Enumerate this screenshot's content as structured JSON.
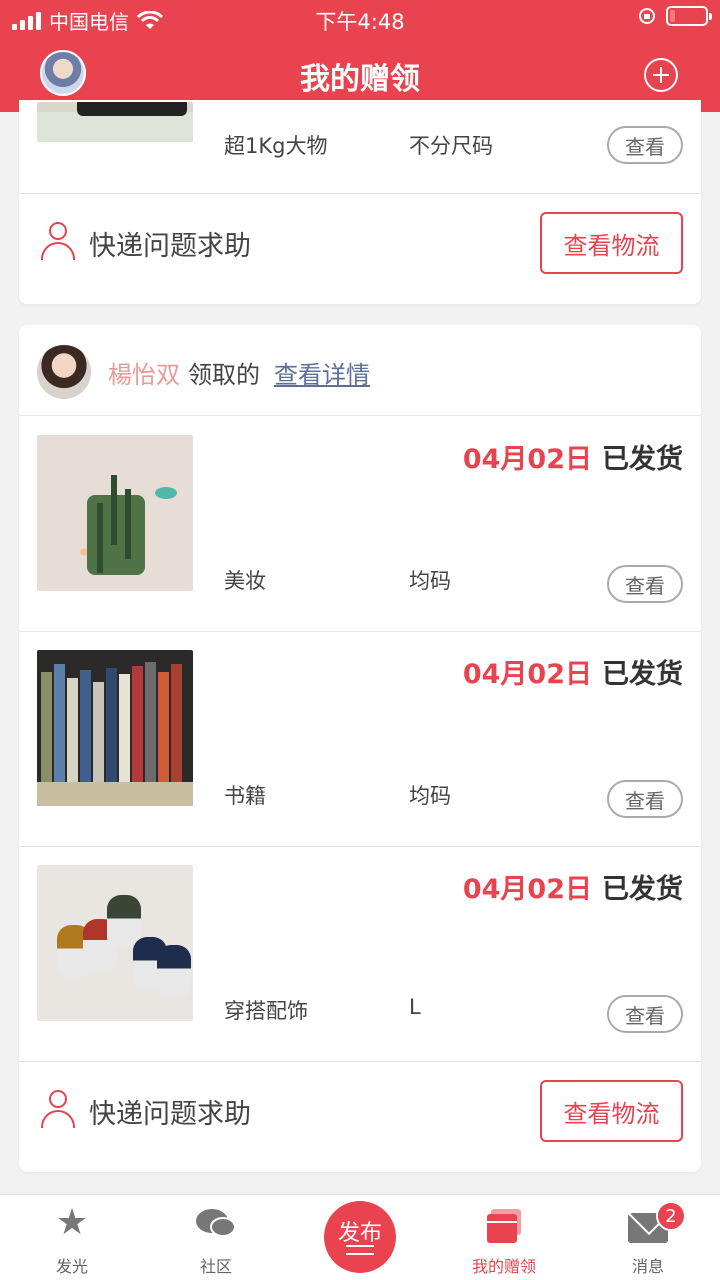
{
  "status_bar": {
    "carrier": "中国电信",
    "time": "下午4:48",
    "battery_level": 0.15
  },
  "header": {
    "title": "我的赠领"
  },
  "card1": {
    "item": {
      "category": "超1Kg大物",
      "size": "不分尺码",
      "view_label": "查看"
    },
    "help_text": "快递问题求助",
    "track_label": "查看物流"
  },
  "card2": {
    "receiver_name": "楊怡双",
    "receiver_action": "领取的",
    "details_link": "查看详情",
    "items": [
      {
        "date": "04月02日",
        "status": "已发货",
        "category": "美妆",
        "size": "均码",
        "view_label": "查看"
      },
      {
        "date": "04月02日",
        "status": "已发货",
        "category": "书籍",
        "size": "均码",
        "view_label": "查看"
      },
      {
        "date": "04月02日",
        "status": "已发货",
        "category": "穿搭配饰",
        "size": "L",
        "view_label": "查看"
      }
    ],
    "help_text": "快递问题求助",
    "track_label": "查看物流"
  },
  "tabbar": {
    "tabs": [
      {
        "label": "发光",
        "icon": "star-icon"
      },
      {
        "label": "社区",
        "icon": "chat-bubbles-icon"
      },
      {
        "label": "发布",
        "icon": "publish-icon"
      },
      {
        "label": "我的赠领",
        "icon": "gift-cards-icon"
      },
      {
        "label": "消息",
        "icon": "mail-icon"
      }
    ],
    "message_badge": "2"
  },
  "colors": {
    "accent": "#e8434f",
    "receiver_name": "#e79a9a",
    "link": "#5b6f9a"
  }
}
